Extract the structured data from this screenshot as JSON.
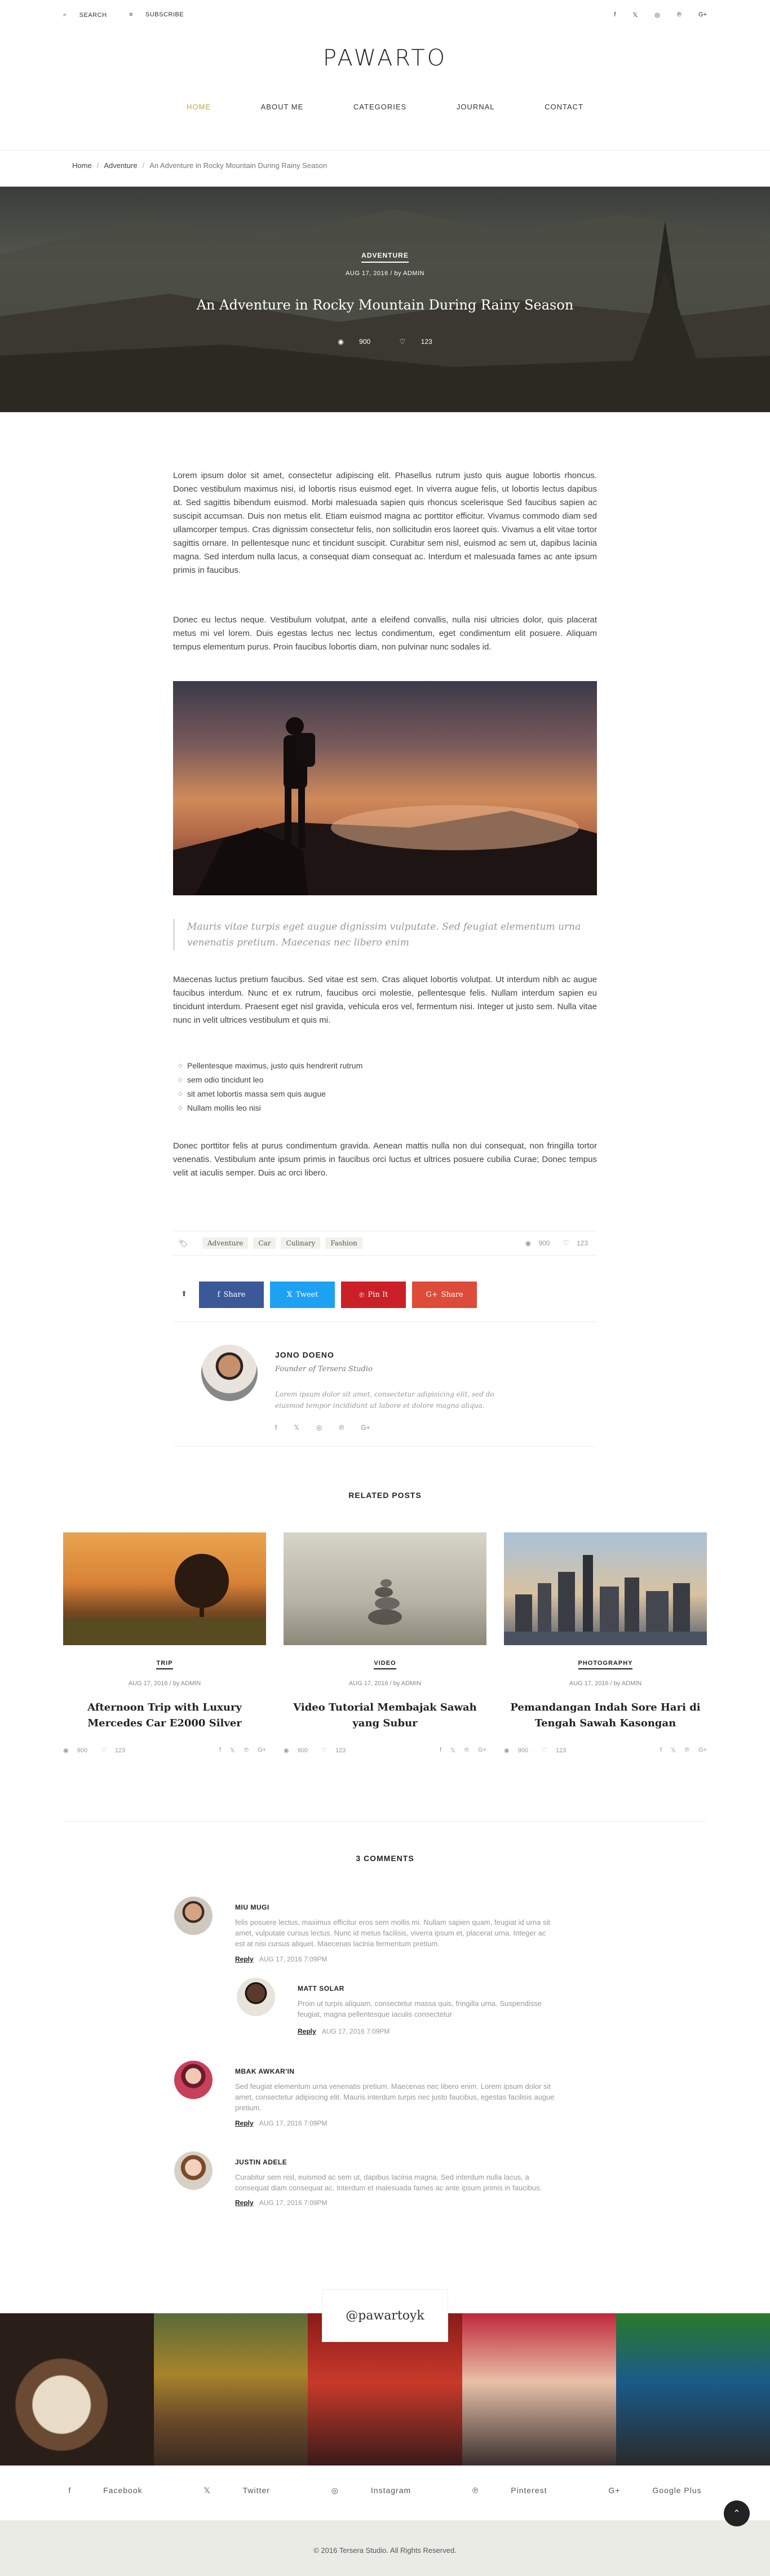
{
  "topbar": {
    "search_label": "SEARCH",
    "subscribe_label": "SUBSCRIBE",
    "social_icons": [
      "facebook-icon",
      "twitter-icon",
      "instagram-icon",
      "pinterest-icon",
      "google-plus-icon"
    ]
  },
  "site": {
    "logo": "PAWARTO"
  },
  "nav": {
    "items": [
      "HOME",
      "ABOUT ME",
      "CATEGORIES",
      "JOURNAL",
      "CONTACT"
    ],
    "active": "HOME"
  },
  "breadcrumb": {
    "home": "Home",
    "section": "Adventure",
    "current": "An Adventure in Rocky Mountain During Rainy Season"
  },
  "hero": {
    "category": "ADVENTURE",
    "meta": "AUG 17, 2016 / by ADMIN",
    "title": "An Adventure in Rocky Mountain During Rainy Season",
    "views": "900",
    "likes": "123"
  },
  "article": {
    "p1": "Lorem ipsum dolor sit amet, consectetur adipiscing elit. Phasellus rutrum justo quis augue lobortis rhoncus. Donec vestibulum maximus nisi, id lobortis risus euismod eget. In viverra augue felis, ut lobortis lectus dapibus at. Sed sagittis bibendum euismod. Morbi malesuada sapien quis rhoncus scelerisque Sed faucibus sapien ac suscipit accumsan. Duis non metus elit. Etiam euismod magna ac porttitor efficitur. Vivamus commodo diam sed ullamcorper tempus. Cras dignissim consectetur felis, non sollicitudin eros laoreet quis. Vivamus a elit vitae tortor sagittis ornare. In pellentesque nunc et tincidunt suscipit. Curabitur sem nisl, euismod ac sem ut, dapibus lacinia magna. Sed interdum nulla lacus, a consequat diam consequat ac. Interdum et malesuada fames ac ante ipsum primis in faucibus.",
    "p2": "Donec eu lectus neque. Vestibulum volutpat, ante a eleifend convallis, nulla nisi ultricies dolor, quis placerat metus mi vel lorem. Duis egestas lectus nec lectus condimentum, eget condimentum elit posuere. Aliquam tempus elementum purus. Proin faucibus lobortis diam, non pulvinar nunc sodales id.",
    "quote": "Mauris vitae turpis eget augue dignissim vulputate. Sed feugiat elementum urna venenatis pretium. Maecenas nec libero enim",
    "p3": "Maecenas luctus pretium faucibus. Sed vitae est sem. Cras aliquet lobortis volutpat. Ut interdum nibh ac augue faucibus interdum. Nunc et ex rutrum, faucibus orci molestie, pellentesque felis. Nullam interdum sapien eu tincidunt interdum. Praesent eget nisl gravida, vehicula eros vel, fermentum nisi. Integer ut justo sem. Nulla vitae nunc in velit ultrices vestibulum et quis mi.",
    "list": [
      "Pellentesque maximus, justo quis hendrerit rutrum",
      "sem odio tincidunt leo",
      "sit amet lobortis massa sem quis augue",
      "Nullam mollis leo nisi"
    ],
    "p4": "Donec porttitor felis at purus condimentum gravida. Aenean mattis nulla non dui consequat, non fringilla tortor venenatis. Vestibulum ante ipsum primis in faucibus orci luctus et ultrices posuere cubilia Curae; Donec tempus velit at iaculis semper. Duis ac orci libero."
  },
  "tags": {
    "items": [
      "Adventure",
      "Car",
      "Culinary",
      "Fashion"
    ],
    "views": "900",
    "likes": "123"
  },
  "share": {
    "buttons": [
      {
        "label": "Share",
        "icon": "facebook-icon",
        "color": "#3b5998"
      },
      {
        "label": "Tweet",
        "icon": "twitter-icon",
        "color": "#1da1f2"
      },
      {
        "label": "Pin It",
        "icon": "pinterest-icon",
        "color": "#cb2027"
      },
      {
        "label": "Share",
        "icon": "google-plus-icon",
        "color": "#dd4b39"
      }
    ]
  },
  "author": {
    "name": "JONO DOENO",
    "role": "Founder of Tersera Studio",
    "bio": "Lorem ipsum dolor sit amet, consectetur adipisicing elit, sed do eiusmod tempor incididunt ut labore et dolore magna aliqua."
  },
  "related": {
    "title": "RELATED POSTS",
    "posts": [
      {
        "category": "TRIP",
        "meta": "AUG 17, 2016 / by ADMIN",
        "title": "Afternoon Trip with Luxury Mercedes Car E2000 Silver",
        "views": "900",
        "likes": "123"
      },
      {
        "category": "VIDEO",
        "meta": "AUG 17, 2016 / by ADMIN",
        "title": "Video Tutorial Membajak Sawah yang Subur",
        "views": "900",
        "likes": "123"
      },
      {
        "category": "PHOTOGRAPHY",
        "meta": "AUG 17, 2016 / by ADMIN",
        "title": "Pemandangan Indah Sore Hari di Tengah Sawah Kasongan",
        "views": "900",
        "likes": "123"
      }
    ]
  },
  "comments": {
    "title": "3 COMMENTS",
    "reply_label": "Reply",
    "items": [
      {
        "name": "MIU MUGI",
        "text": "felis posuere lectus, maximus efficitur eros sem mollis mi. Nullam sapien quam, feugiat id urna sit amet, vulputate cursus lectus. Nunc id metus facilisis, viverra ipsum et, placerat urna. Integer ac est at nisi cursus aliquet. Maecenas lacinia fermentum pretium.",
        "date": "AUG 17, 2016 7:09PM"
      },
      {
        "name": "MATT SOLAR",
        "text": "Proin ut turpis aliquam, consectetur massa quis, fringilla urna. Suspendisse feugiat, magna pellentesque iaculis consectetur",
        "date": "AUG 17, 2016 7:09PM"
      },
      {
        "name": "MBAK AWKAR'IN",
        "text": "Sed feugiat elementum urna venenatis pretium. Maecenas nec libero enim. Lorem ipsum dolor sit amet, consectetur adipiscing elit. Mauris interdum turpis nec justo faucibus, egestas facilisis augue pretium.",
        "date": "AUG 17, 2016 7:09PM"
      },
      {
        "name": "JUSTIN ADELE",
        "text": "Curabitur sem nisl, euismod ac sem ut, dapibus lacinia magna. Sed interdum nulla lacus, a consequat diam consequat ac. Interdum et malesuada fames ac ante ipsum primis in faucibus.",
        "date": "AUG 17, 2016 7:09PM"
      }
    ]
  },
  "instagram": {
    "handle": "@pawartoyk"
  },
  "footer": {
    "links": [
      "Facebook",
      "Twitter",
      "Instagram",
      "Pinterest",
      "Google Plus"
    ],
    "copyright": "© 2016 Tersera Studio. All Rights Reserved."
  }
}
